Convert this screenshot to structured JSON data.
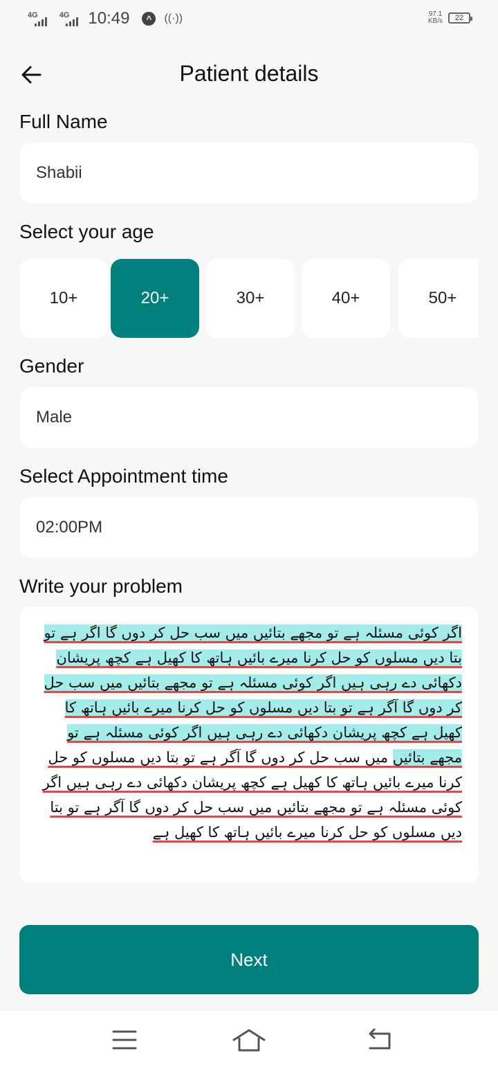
{
  "status_bar": {
    "net1": "4G",
    "net2": "4G",
    "time": "10:49",
    "speed_value": "97.1",
    "speed_unit": "KB/s",
    "battery": "22"
  },
  "header": {
    "title": "Patient details"
  },
  "form": {
    "name_label": "Full Name",
    "name_value": "Shabii",
    "age_label": "Select your age",
    "age_options": [
      "10+",
      "20+",
      "30+",
      "40+",
      "50+"
    ],
    "age_selected": "20+",
    "gender_label": "Gender",
    "gender_value": "Male",
    "time_label": "Select Appointment time",
    "time_value": "02:00PM",
    "problem_label": "Write your problem",
    "problem_highlighted": "اگر کوئی مسئلہ ہے تو مجھے بتائیں میں سب حل کر دوں گا اگر ہے تو بتا دیں مسلوں کو حل کرنا میرے بائیں ہاتھ کا کھیل ہے کچھ پریشان دکھائی دے رہی ہیں اگر کوئی مسئلہ ہے تو مجھے بتائیں میں سب حل کر دوں گا آگر ہے تو بتا دیں مسلوں کو حل کرنا میرے بائیں ہاتھ کا کھیل ہے کچھ پریشان دکھائی دے رہی ہیں اگر کوئی مسئلہ ہے تو مجھے بتائیں",
    "problem_rest": " میں سب حل کر دوں گا آگر ہے تو بتا دیں مسلوں کو حل کرنا میرے بائیں ہاتھ کا کھیل ہے کچھ پریشان دکھائی دے رہی ہیں اگر کوئی مسئلہ ہے تو مجھے بتائیں میں سب حل کر دوں گا آگر ہے تو بتا دیں مسلوں کو حل کرنا میرے بائیں ہاتھ کا کھیل ہے"
  },
  "next_label": "Next",
  "colors": {
    "accent": "#007f7c",
    "highlight": "#a3ece9",
    "spell_underline": "#e04848"
  },
  "icons": [
    "back-arrow-icon",
    "menu-icon",
    "home-icon",
    "back-nav-icon",
    "hotspot-icon"
  ]
}
